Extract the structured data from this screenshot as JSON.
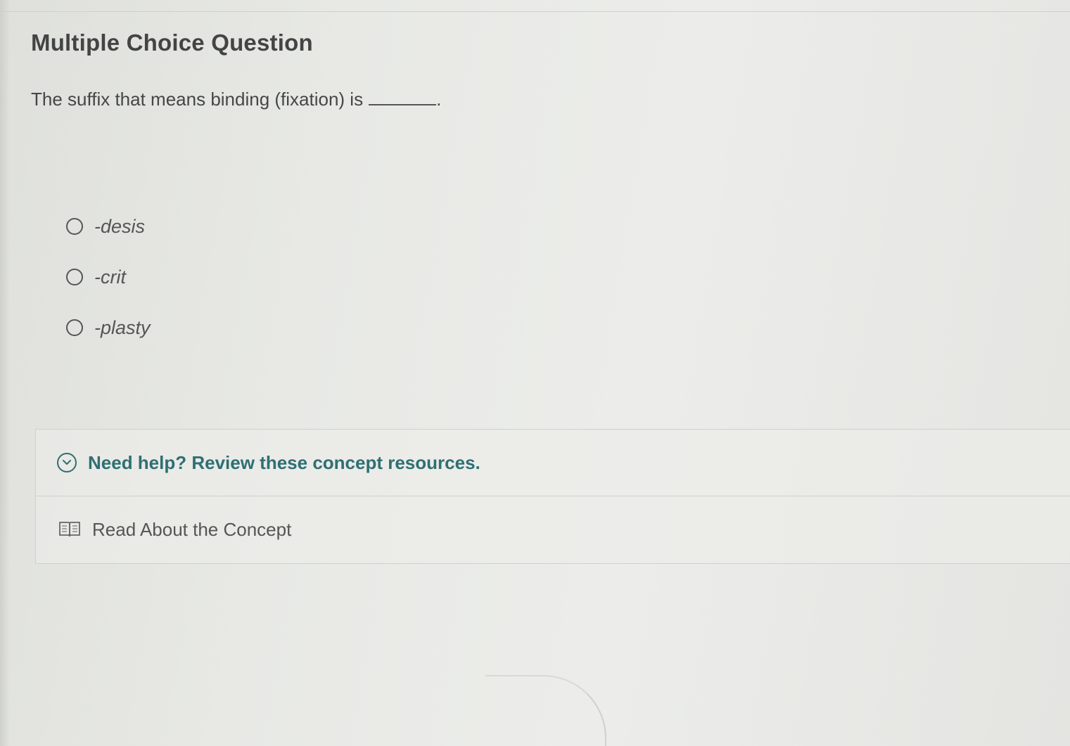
{
  "title": "Multiple Choice Question",
  "question": {
    "text": "The suffix that means binding (fixation) is",
    "end_punctuation": "."
  },
  "options": [
    {
      "label": "-desis",
      "selected": false
    },
    {
      "label": "-crit",
      "selected": false
    },
    {
      "label": "-plasty",
      "selected": false
    }
  ],
  "help": {
    "toggle_label": "Need help? Review these concept resources.",
    "toggle_icon": "chevron-down-circle-icon",
    "resources": [
      {
        "label": "Read About the Concept",
        "icon": "book-icon"
      }
    ]
  },
  "colors": {
    "accent": "#2f6f73",
    "text": "#464646",
    "background": "#e8e9e5"
  }
}
